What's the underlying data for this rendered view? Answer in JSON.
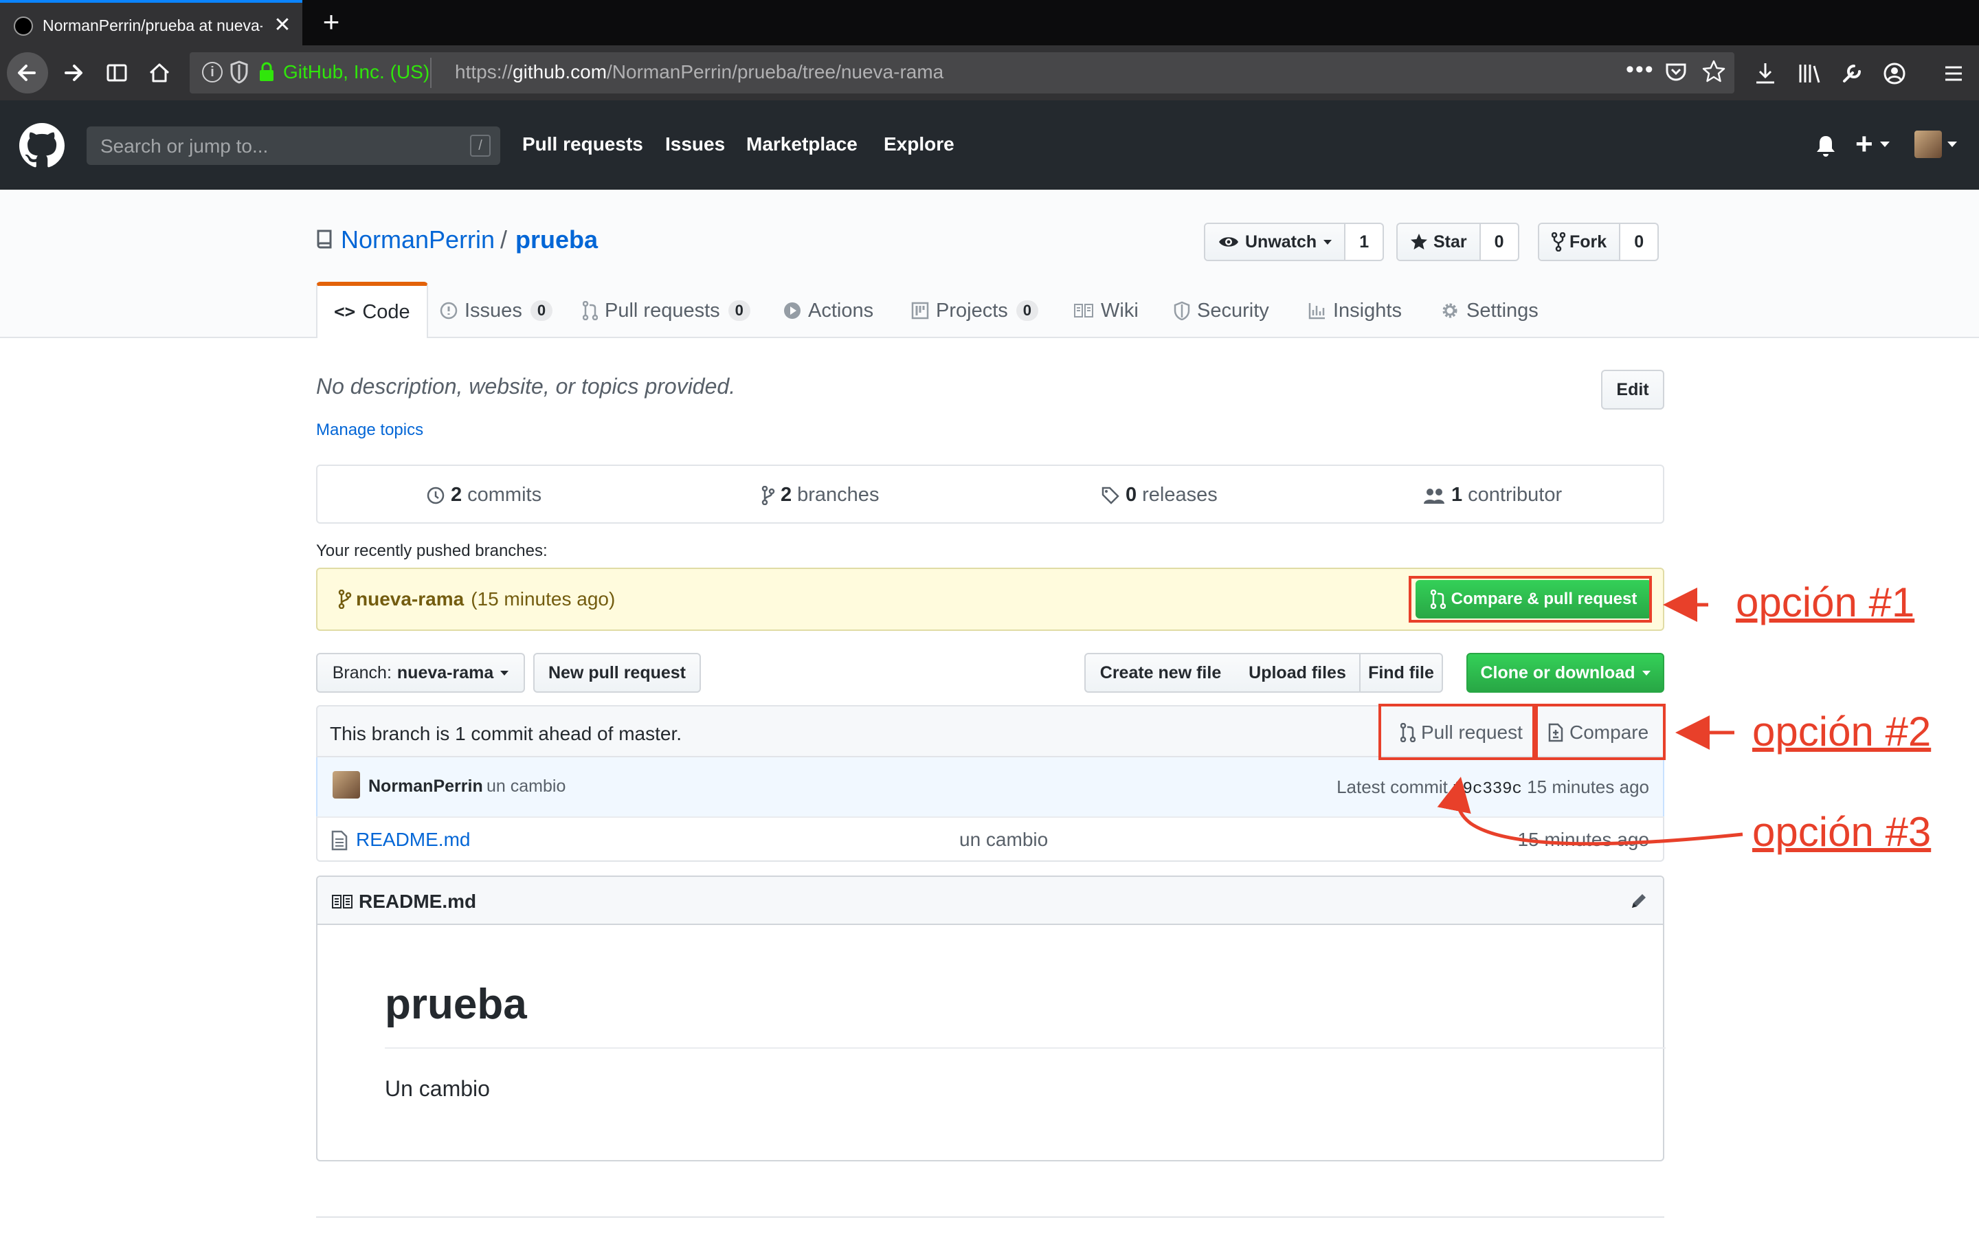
{
  "browser": {
    "tab_title": "NormanPerrin/prueba at nueva-rama",
    "url_company": "GitHub, Inc. (US)",
    "url_prefix": "https://",
    "url_host": "github.com",
    "url_path": "/NormanPerrin/prueba/tree/nueva-rama",
    "url_more": "•••",
    "tab_close": "✕",
    "new_tab": "+"
  },
  "header": {
    "search_placeholder": "Search or jump to...",
    "search_key": "/",
    "nav": [
      "Pull requests",
      "Issues",
      "Marketplace",
      "Explore"
    ],
    "plus": "+"
  },
  "repo": {
    "owner": "NormanPerrin",
    "separator": "/",
    "name": "prueba",
    "watch_label": "Unwatch",
    "watch_count": "1",
    "star_label": "Star",
    "star_count": "0",
    "fork_label": "Fork",
    "fork_count": "0",
    "tabs": [
      {
        "label": "Code",
        "icon": "code-icon"
      },
      {
        "label": "Issues",
        "count": "0",
        "icon": "issue-icon"
      },
      {
        "label": "Pull requests",
        "count": "0",
        "icon": "pull-request-icon"
      },
      {
        "label": "Actions",
        "icon": "play-icon"
      },
      {
        "label": "Projects",
        "count": "0",
        "icon": "project-icon"
      },
      {
        "label": "Wiki",
        "icon": "book-icon"
      },
      {
        "label": "Security",
        "icon": "shield-icon"
      },
      {
        "label": "Insights",
        "icon": "graph-icon"
      },
      {
        "label": "Settings",
        "icon": "gear-icon"
      }
    ]
  },
  "main": {
    "description": "No description, website, or topics provided.",
    "manage_topics": "Manage topics",
    "edit_label": "Edit",
    "summary": {
      "commits_count": "2",
      "commits_label": "commits",
      "branches_count": "2",
      "branches_label": "branches",
      "releases_count": "0",
      "releases_label": "releases",
      "contributors_count": "1",
      "contributors_label": "contributor"
    },
    "recent_label": "Your recently pushed branches:",
    "recent_branch": "nueva-rama",
    "recent_time": "(15 minutes ago)",
    "compare_pr_label": "Compare & pull request",
    "branch_prefix": "Branch:",
    "branch_name": "nueva-rama",
    "new_pr_label": "New pull request",
    "create_file_label": "Create new file",
    "upload_files_label": "Upload files",
    "find_file_label": "Find file",
    "clone_label": "Clone or download",
    "ahead_text": "This branch is 1 commit ahead of master.",
    "pr_link": "Pull request",
    "compare_link": "Compare",
    "commit": {
      "author": "NormanPerrin",
      "message": "un cambio",
      "latest_prefix": "Latest commit",
      "sha": "f9c339c",
      "time": "15 minutes ago"
    },
    "files": [
      {
        "name": "README.md",
        "message": "un cambio",
        "age": "15 minutes ago"
      }
    ],
    "readme": {
      "title": "README.md",
      "heading": "prueba",
      "body": "Un cambio"
    }
  },
  "annotations": {
    "option1": "opción #1",
    "option2": "opción #2",
    "option3": "opción #3",
    "color": "#e8402a"
  },
  "colors": {
    "accent_orange": "#e36209",
    "link_blue": "#0366d6",
    "green": "#28a745",
    "header_dark": "#24292e"
  }
}
